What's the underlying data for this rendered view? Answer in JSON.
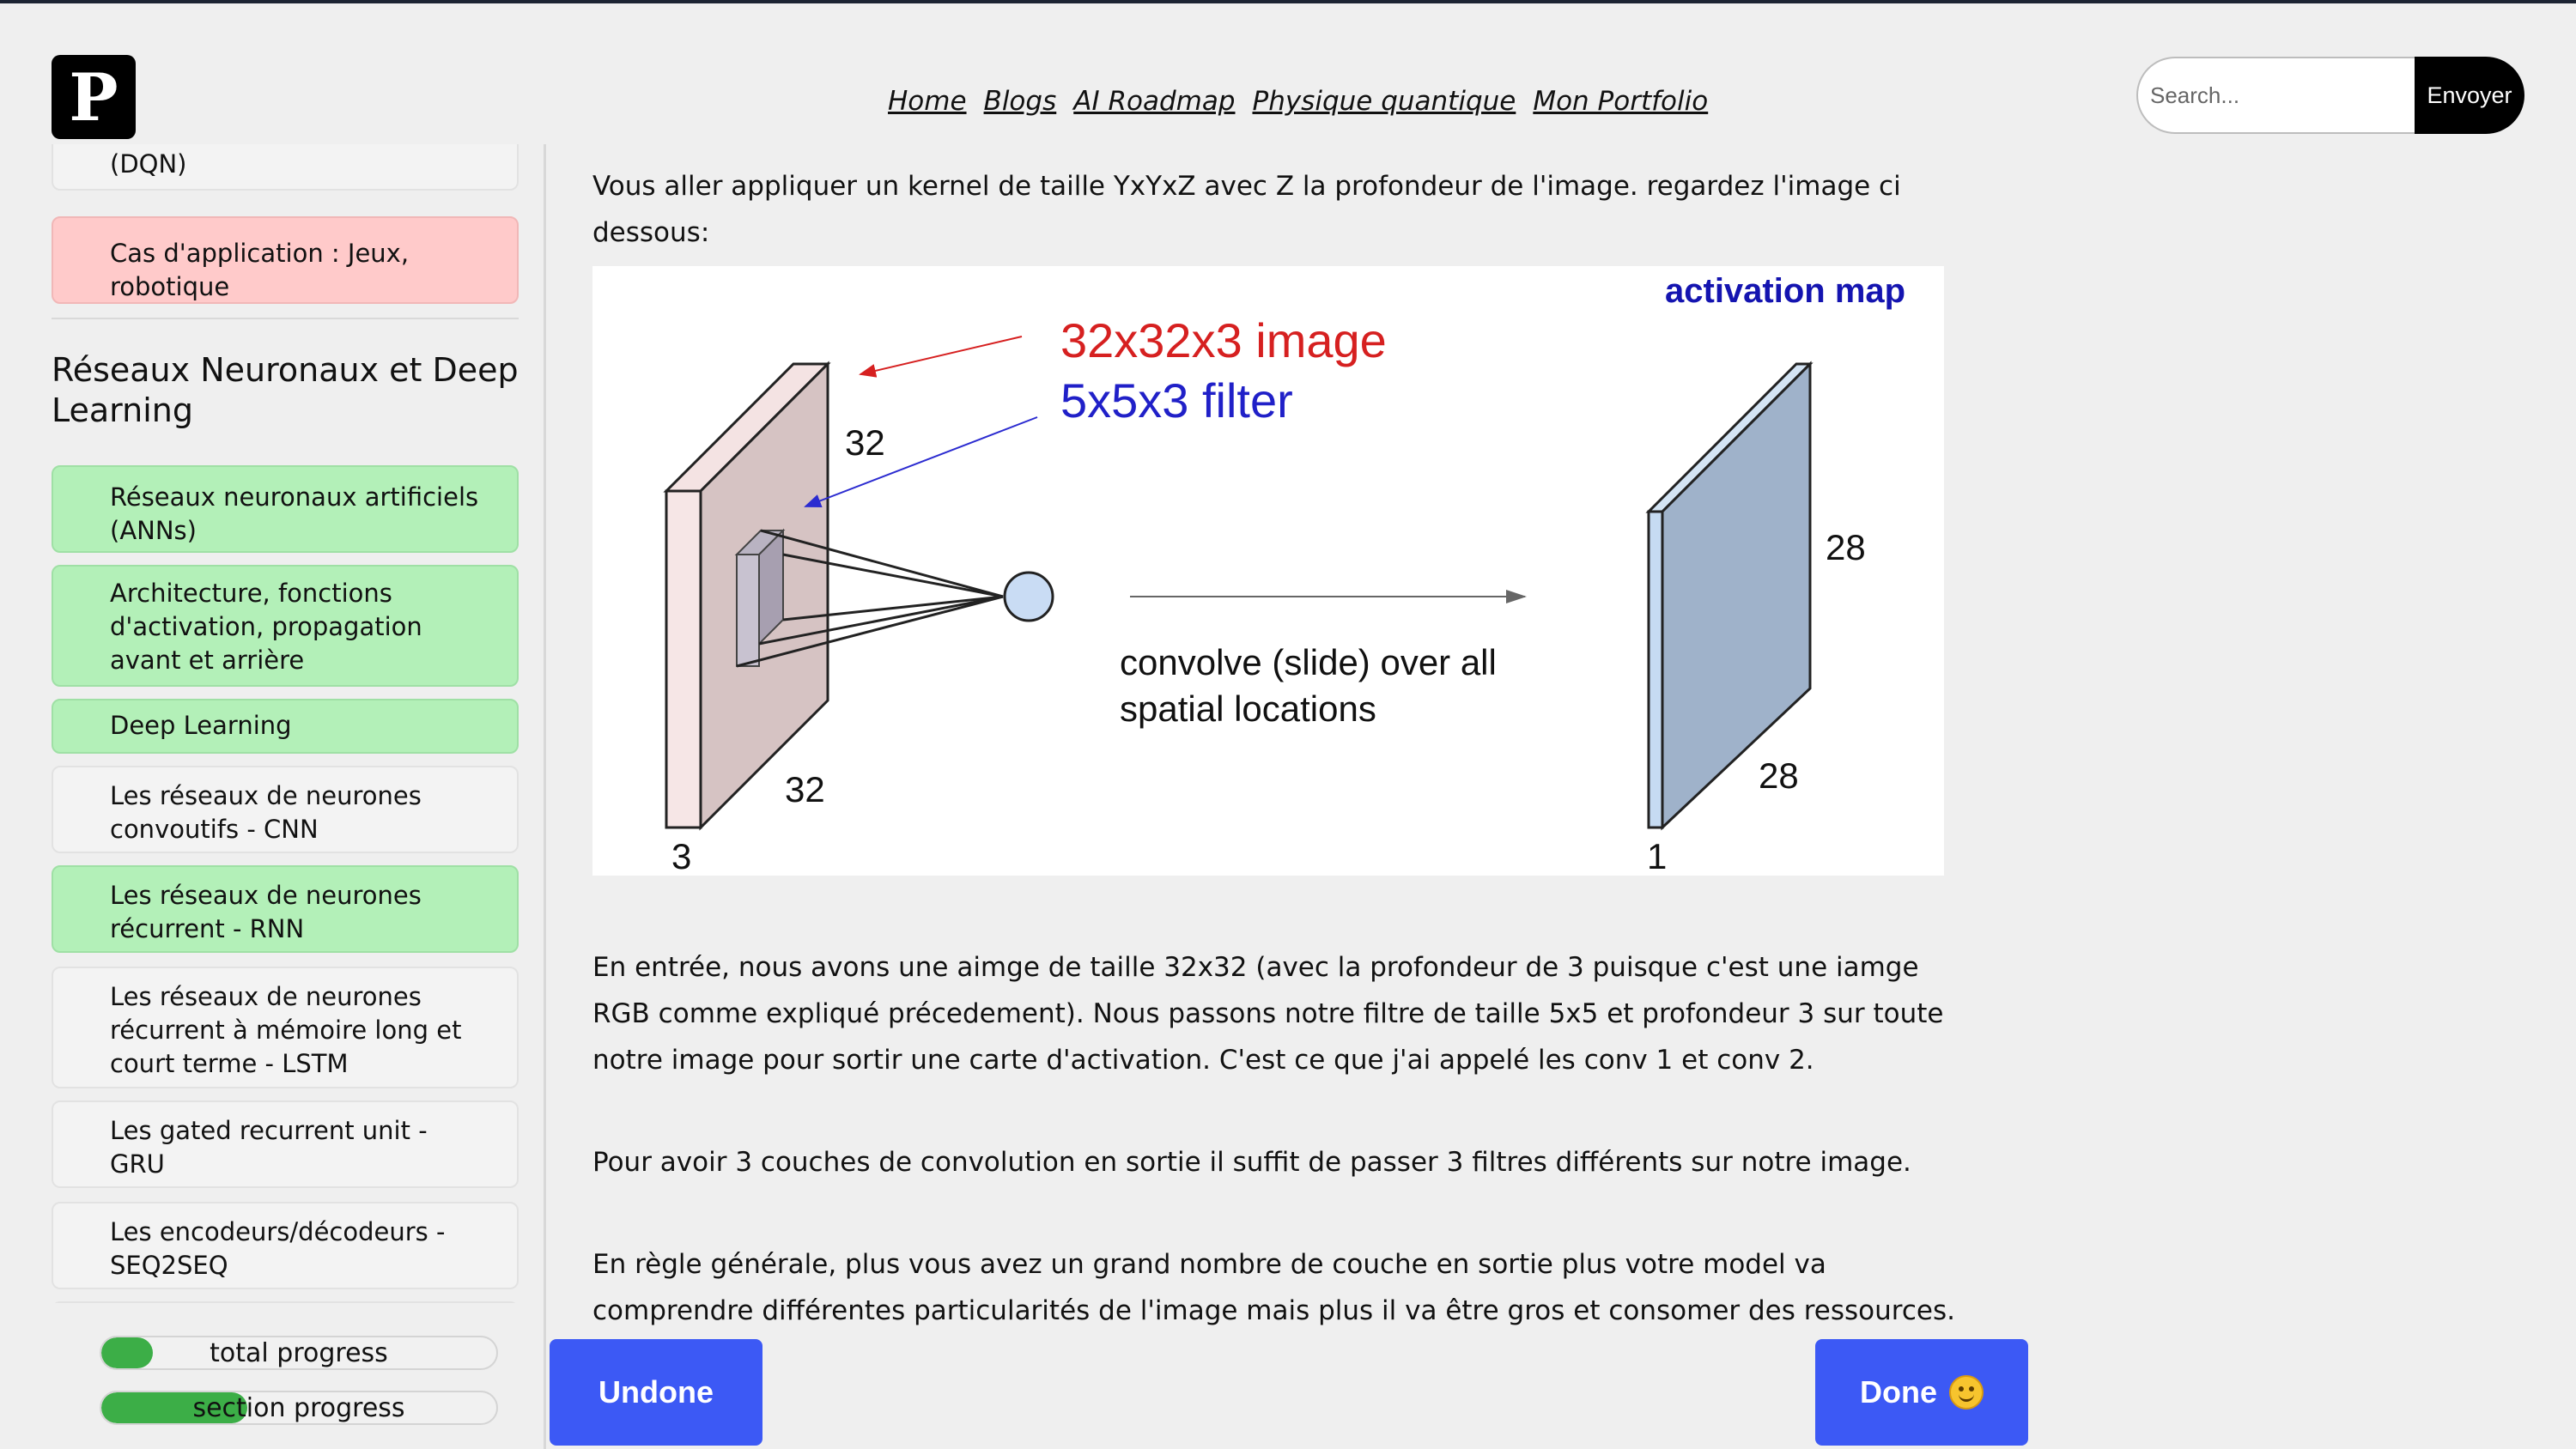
{
  "header": {
    "logo_letter": "P",
    "nav": [
      "Home",
      "Blogs",
      "AI Roadmap",
      "Physique quantique",
      "Mon Portfolio"
    ],
    "search": {
      "placeholder": "Search...",
      "button_label": "Envoyer"
    }
  },
  "sidebar": {
    "items_top": [
      {
        "label": "(DQN)",
        "status": "neutral"
      },
      {
        "label": "Cas d'application : Jeux, robotique",
        "status": "red"
      }
    ],
    "section_title": "Réseaux Neuronaux et Deep Learning",
    "items": [
      {
        "label": "Réseaux neuronaux artificiels (ANNs)",
        "status": "green"
      },
      {
        "label": "Architecture, fonctions d'activation, propagation avant et arrière",
        "status": "green"
      },
      {
        "label": "Deep Learning",
        "status": "green"
      },
      {
        "label": "Les réseaux de neurones convoutifs - CNN",
        "status": "neutral"
      },
      {
        "label": "Les réseaux de neurones récurrent - RNN",
        "status": "green"
      },
      {
        "label": "Les réseaux de neurones récurrent à mémoire long et court terme - LSTM",
        "status": "neutral"
      },
      {
        "label": "Les gated recurrent unit - GRU",
        "status": "neutral"
      },
      {
        "label": "Les encodeurs/décodeurs - SEQ2SEQ",
        "status": "neutral"
      }
    ],
    "progress": [
      {
        "label": "total progress",
        "fraction": 0.13
      },
      {
        "label": "section progress",
        "fraction": 0.37
      }
    ]
  },
  "content": {
    "intro": "Vous aller appliquer un kernel de taille YxYxZ avec Z la profondeur de l'image. regardez l'image ci dessous:",
    "figure": {
      "title": "activation map",
      "label_image": "32x32x3 image",
      "label_filter": "5x5x3 filter",
      "dim_input_height": "32",
      "dim_input_width": "32",
      "dim_input_depth": "3",
      "caption_line1": "convolve (slide) over all",
      "caption_line2": "spatial locations",
      "dim_output_height": "28",
      "dim_output_width": "28",
      "dim_output_depth": "1"
    },
    "paragraph1": "En entrée, nous avons une aimge de taille 32x32 (avec la profondeur de 3 puisque c'est une iamge RGB comme expliqué précedement). Nous passons notre filtre de taille 5x5 et profondeur 3 sur toute notre image pour sortir une carte d'activation. C'est ce que j'ai appelé les conv 1 et conv 2.",
    "paragraph2": "Pour avoir 3 couches de convolution en sortie il suffit de passer 3 filtres différents sur notre image.",
    "paragraph3": "En règle générale, plus vous avez un grand nombre de couche en sortie plus votre model va comprendre différentes particularités de l'image mais plus il va être gros et consomer des ressources."
  },
  "buttons": {
    "undone": "Undone",
    "done": "Done"
  }
}
